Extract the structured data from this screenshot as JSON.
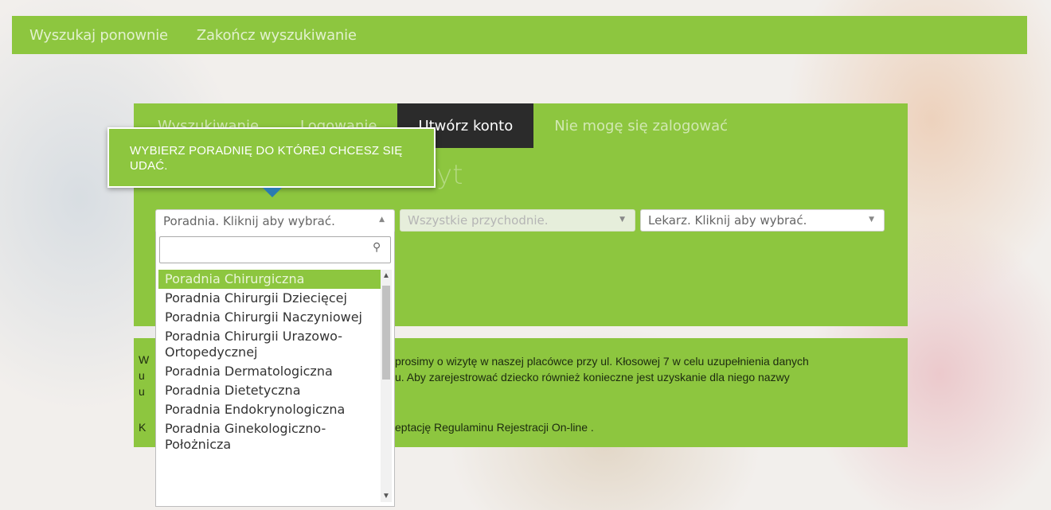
{
  "topbar": {
    "links": [
      "Wyszukaj ponownie",
      "Zakończ wyszukiwanie"
    ]
  },
  "tabs": [
    "Wyszukiwanie",
    "Logowanie",
    "Utwórz konto",
    "Nie mogę się zalogować"
  ],
  "active_tab": "Utwórz konto",
  "heading_fragment": "yt",
  "tooltip": {
    "text": "WYBIERZ PORADNIĘ DO KTÓREJ CHCESZ SIĘ UDAĆ."
  },
  "selects": {
    "clinic_type": {
      "value": "Poradnia. Kliknij aby wybrać."
    },
    "clinic": {
      "value": "Wszystkie przychodnie."
    },
    "doctor": {
      "value": "Lekarz. Kliknij aby wybrać."
    }
  },
  "dropdown": {
    "search_value": "",
    "options": [
      "Poradnia Chirurgiczna",
      "Poradnia Chirurgii Dziecięcej",
      "Poradnia Chirurgii Naczyniowej",
      "Poradnia Chirurgii Urazowo-Ortopedycznej",
      "Poradnia Dermatologiczna",
      "Poradnia Dietetyczna",
      "Poradnia Endokrynologiczna",
      "Poradnia Ginekologiczno-Położnicza"
    ],
    "highlighted": "Poradnia Chirurgiczna"
  },
  "info": {
    "line1": "prosimy o wizytę w naszej placówce przy ul. Kłosowej 7 w celu uzupełnienia danych",
    "line2": "u. Aby zarejestrować dziecko również konieczne jest uzyskanie dla niego nazwy",
    "line3": "eptację Regulaminu Rejestracji On-line .",
    "left_fragments": [
      "W",
      "u",
      "u",
      "K"
    ]
  },
  "colors": {
    "accent": "#8dc63f",
    "tab_active": "#2b2b2b",
    "tip_arrow": "#2a7ab0"
  }
}
